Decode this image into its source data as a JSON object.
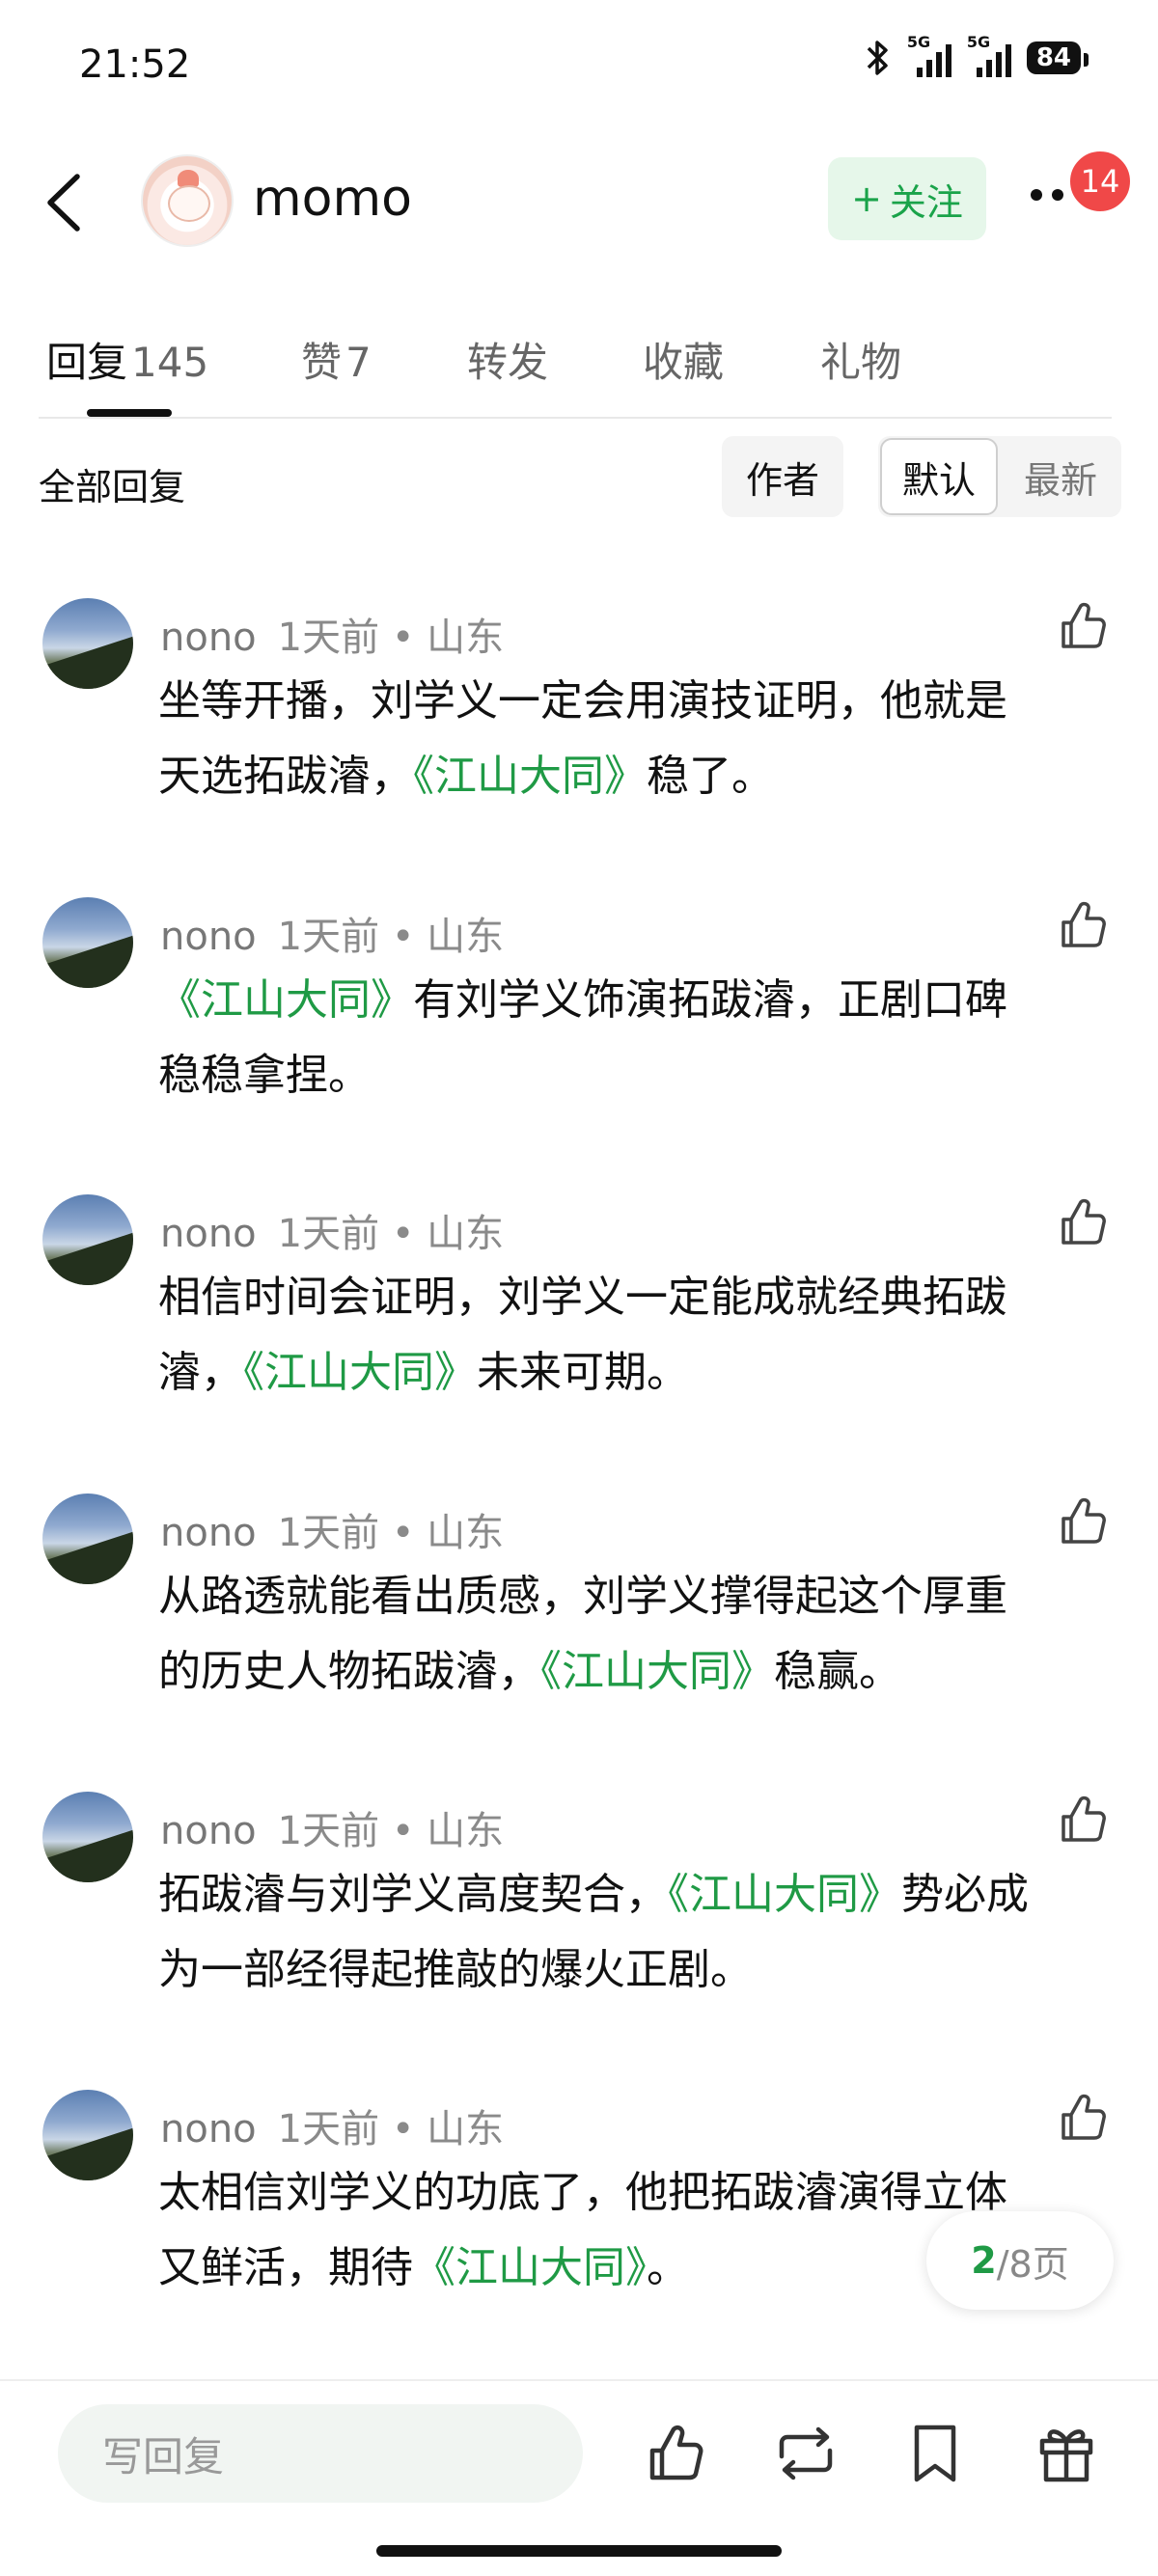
{
  "status_bar": {
    "time": "21:52",
    "signal1": "5G",
    "signal2": "5G",
    "battery": "84"
  },
  "header": {
    "username": "momo",
    "follow_label": "关注",
    "follow_plus": "+",
    "notification_count": "14"
  },
  "tabs": [
    {
      "label": "回复",
      "count": "145"
    },
    {
      "label": "赞",
      "count": "7"
    },
    {
      "label": "转发",
      "count": ""
    },
    {
      "label": "收藏",
      "count": ""
    },
    {
      "label": "礼物",
      "count": ""
    }
  ],
  "filter": {
    "title": "全部回复",
    "author_chip": "作者",
    "sort_default": "默认",
    "sort_latest": "最新"
  },
  "comments": [
    {
      "name": "nono",
      "meta": "1天前 • 山东",
      "line1_pre": "坐等开播，刘学义一定会用演技证明，他就是",
      "line1_hl": "",
      "line1_post": "",
      "line2_pre": "天选拓跋濬，",
      "line2_hl": "《江山大同》",
      "line2_post": "稳了。"
    },
    {
      "name": "nono",
      "meta": "1天前 • 山东",
      "line1_pre": "",
      "line1_hl": "《江山大同》",
      "line1_post": "有刘学义饰演拓跋濬，正剧口碑",
      "line2_pre": "稳稳拿捏。",
      "line2_hl": "",
      "line2_post": ""
    },
    {
      "name": "nono",
      "meta": "1天前 • 山东",
      "line1_pre": "相信时间会证明，刘学义一定能成就经典拓跋",
      "line1_hl": "",
      "line1_post": "",
      "line2_pre": "濬，",
      "line2_hl": "《江山大同》",
      "line2_post": "未来可期。"
    },
    {
      "name": "nono",
      "meta": "1天前 • 山东",
      "line1_pre": "从路透就能看出质感，刘学义撑得起这个厚重",
      "line1_hl": "",
      "line1_post": "",
      "line2_pre": "的历史人物拓跋濬，",
      "line2_hl": "《江山大同》",
      "line2_post": "稳赢。"
    },
    {
      "name": "nono",
      "meta": "1天前 • 山东",
      "line1_pre": "拓跋濬与刘学义高度契合，",
      "line1_hl": "《江山大同》",
      "line1_post": "势必成",
      "line2_pre": "为一部经得起推敲的爆火正剧。",
      "line2_hl": "",
      "line2_post": ""
    },
    {
      "name": "nono",
      "meta": "1天前 • 山东",
      "line1_pre": "太相信刘学义的功底了，他把拓跋濬演得立体",
      "line1_hl": "",
      "line1_post": "",
      "line2_pre": "又鲜活，期待",
      "line2_hl": "《江山大同》",
      "line2_post": "。"
    }
  ],
  "pagination": {
    "current": "2",
    "total": "/8页"
  },
  "bottom_bar": {
    "reply_placeholder": "写回复"
  },
  "colors": {
    "accent_green": "#1f9a45",
    "badge_red": "#f04848"
  }
}
